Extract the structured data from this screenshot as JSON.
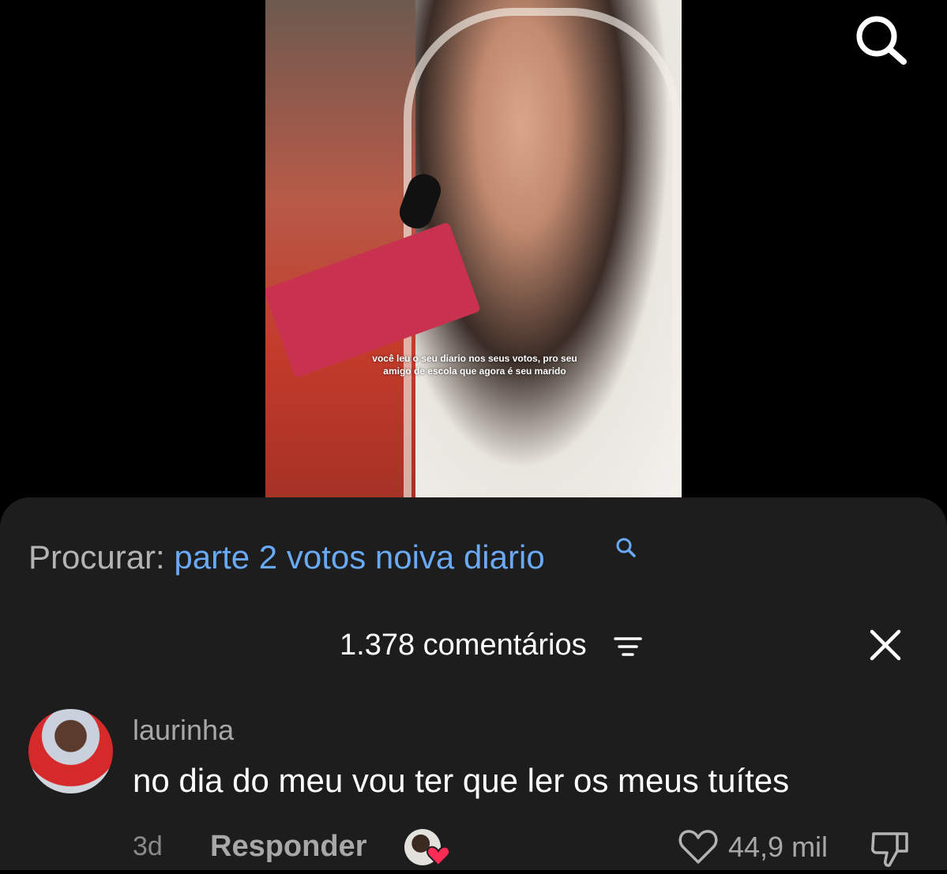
{
  "video": {
    "caption_line1": "você leu o seu diario nos seus votos, pro seu",
    "caption_line2": "amigo de escola que agora é seu marido"
  },
  "top_bar": {
    "search_icon": "search-icon"
  },
  "search_suggestion": {
    "label": "Procurar: ",
    "query": "parte 2 votos noiva diario",
    "icon": "search-icon"
  },
  "comments": {
    "header": "1.378 comentários",
    "filter_icon": "filter-icon",
    "close_icon": "close-icon",
    "items": [
      {
        "username": "laurinha",
        "text": "no dia do meu vou ter que ler os meus tuítes",
        "time": "3d",
        "reply_label": "Responder",
        "likes": "44,9 mil"
      }
    ]
  },
  "colors": {
    "panel_bg": "#1d1d1d",
    "link_blue": "#6aa9f5",
    "heart_red": "#fe2c55",
    "muted_text": "#a8a8a8"
  }
}
